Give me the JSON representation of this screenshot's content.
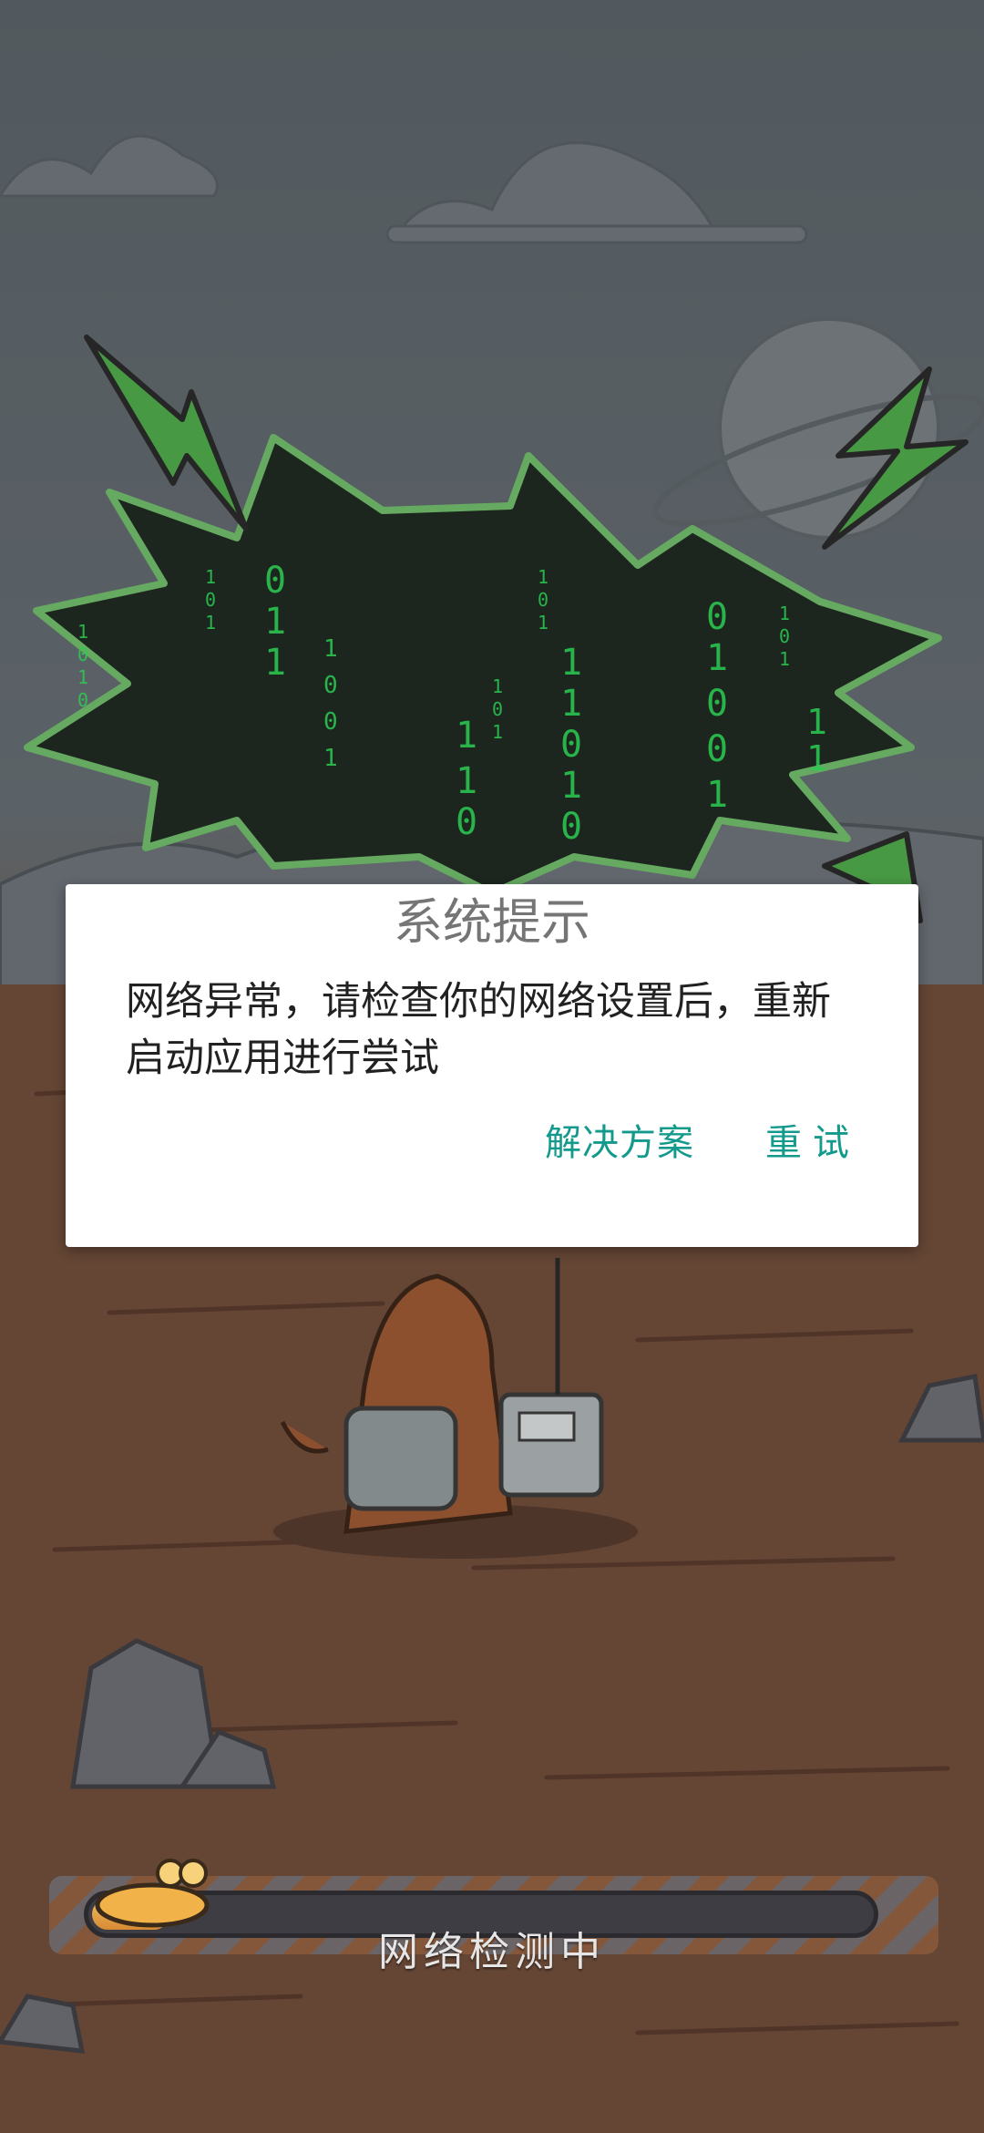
{
  "dialog": {
    "title": "系统提示",
    "message": "网络异常，请检查你的网络设置后，重新启动应用进行尝试",
    "buttons": {
      "solution": "解决方案",
      "retry": "重试"
    }
  },
  "loading": {
    "status_text": "网络检测中",
    "progress": 0.1
  },
  "colors": {
    "accent": "#139a8c",
    "matrix_green": "#2fe05a",
    "dialog_bg": "#ffffff"
  },
  "icons": [
    "lightning-bolt-icon",
    "planet-icon",
    "monkey-with-radio-illustration",
    "snail-icon"
  ]
}
